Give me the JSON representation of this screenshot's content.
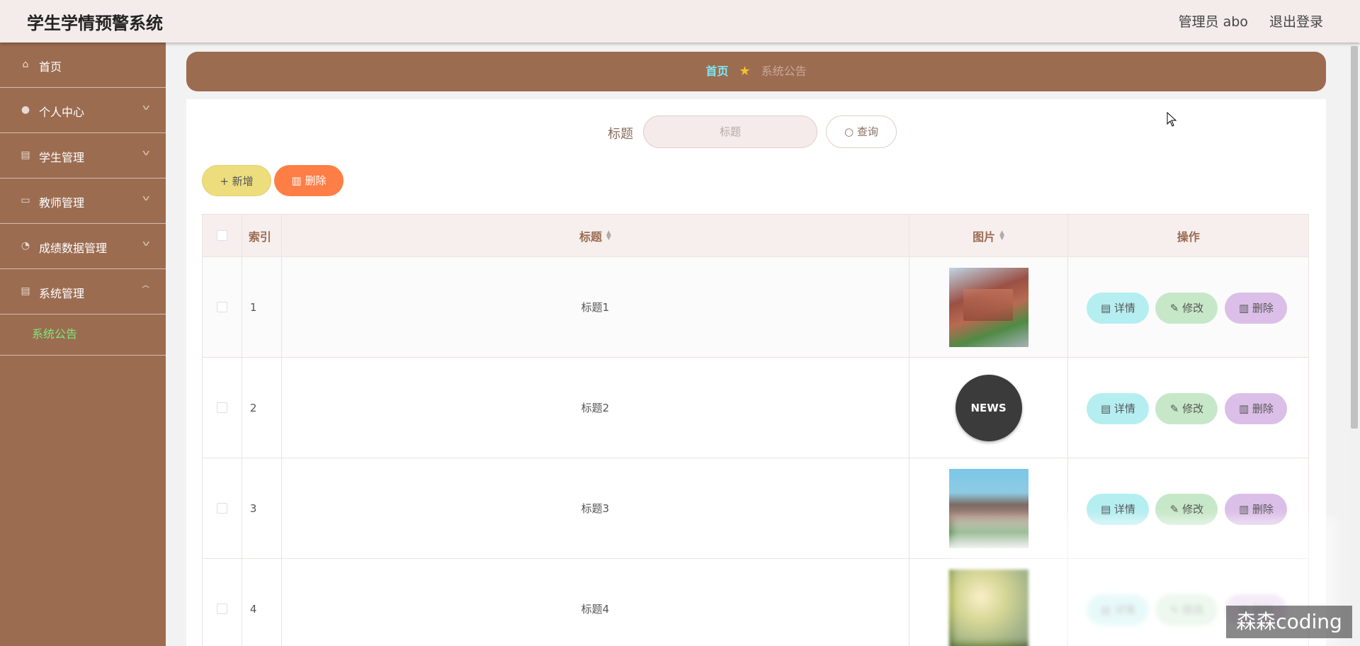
{
  "header": {
    "app_title": "学生学情预警系统",
    "admin_label": "管理员 abo",
    "logout_label": "退出登录"
  },
  "sidebar": {
    "items": [
      {
        "label": "首页",
        "icon": "home-icon"
      },
      {
        "label": "个人中心",
        "icon": "user-icon"
      },
      {
        "label": "学生管理",
        "icon": "clipboard-icon"
      },
      {
        "label": "教师管理",
        "icon": "id-card-icon"
      },
      {
        "label": "成绩数据管理",
        "icon": "compass-icon"
      },
      {
        "label": "系统管理",
        "icon": "clipboard-icon"
      }
    ],
    "submenu": {
      "label": "系统公告"
    }
  },
  "breadcrumb": {
    "home": "首页",
    "current": "系统公告"
  },
  "search": {
    "label": "标题",
    "placeholder": "标题",
    "button_label": "查询"
  },
  "toolbar": {
    "add_label": "新增",
    "delete_label": "删除"
  },
  "table": {
    "columns": [
      "索引",
      "标题",
      "图片",
      "操作"
    ],
    "rows": [
      {
        "index": "1",
        "title": "标题1",
        "image": "campus-building-photo"
      },
      {
        "index": "2",
        "title": "标题2",
        "image": "news-globe-icon"
      },
      {
        "index": "3",
        "title": "标题3",
        "image": "school-building-photo"
      },
      {
        "index": "4",
        "title": "标题4",
        "image": "garden-photo"
      }
    ],
    "row_actions": {
      "detail": "详情",
      "edit": "修改",
      "delete": "删除"
    }
  },
  "news_badge_text": "NEWS",
  "watermark": "森森coding",
  "colors": {
    "sidebar_bg": "#9c6c51",
    "breadcrumb_active": "#7de8f2",
    "submenu_active": "#7be87b",
    "add_button": "#eedd7d",
    "delete_button": "#ff7e45",
    "detail_button": "#b5eef1",
    "edit_button": "#c7e8c8",
    "row_delete_button": "#dbbfe8"
  }
}
